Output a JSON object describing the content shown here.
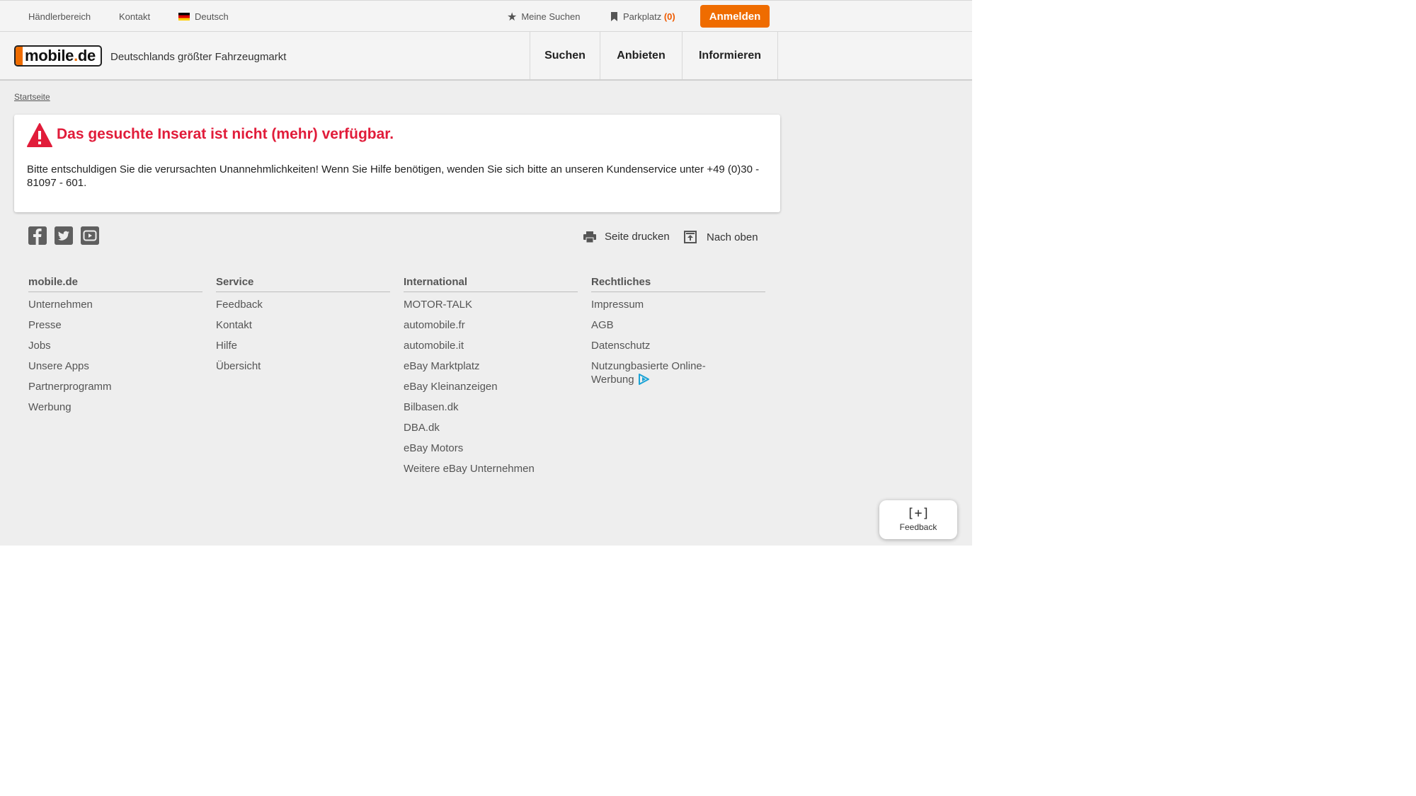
{
  "topbar": {
    "dealer_area": "Händlerbereich",
    "contact": "Kontakt",
    "language": "Deutsch",
    "saved_searches": "Meine Suchen",
    "parking": "Parkplatz",
    "parking_count": "(0)",
    "login": "Anmelden"
  },
  "header": {
    "logo_text": "mobile",
    "logo_dot": ".",
    "logo_tld": "de",
    "tagline": "Deutschlands größter Fahrzeugmarkt",
    "nav": [
      "Suchen",
      "Anbieten",
      "Informieren"
    ]
  },
  "breadcrumb": "Startseite",
  "alert": {
    "title": "Das gesuchte Inserat ist nicht (mehr) verfügbar.",
    "message": "Bitte entschuldigen Sie die verursachten Unannehmlichkeiten! Wenn Sie Hilfe benötigen, wenden Sie sich bitte an unseren Kundenservice unter +49 (0)30 - 81097 - 601."
  },
  "tools": {
    "print": "Seite drucken",
    "top": "Nach oben"
  },
  "footer": {
    "columns": [
      {
        "title": "mobile.de",
        "links": [
          "Unternehmen",
          "Presse",
          "Jobs",
          "Unsere Apps",
          "Partnerprogramm",
          "Werbung"
        ]
      },
      {
        "title": "Service",
        "links": [
          "Feedback",
          "Kontakt",
          "Hilfe",
          "Übersicht"
        ]
      },
      {
        "title": "International",
        "links": [
          "MOTOR-TALK",
          "automobile.fr",
          "automobile.it",
          "eBay Marktplatz",
          "eBay Kleinanzeigen",
          "Bilbasen.dk",
          "DBA.dk",
          "eBay Motors",
          "Weitere eBay Unternehmen"
        ]
      },
      {
        "title": "Rechtliches",
        "links": [
          "Impressum",
          "AGB",
          "Datenschutz"
        ],
        "ad_link": "Nutzungbasierte Online-Werbung"
      }
    ]
  },
  "feedback_widget": {
    "icon": "[+]",
    "label": "Feedback"
  },
  "colors": {
    "accent": "#ef6c00",
    "error": "#e11c3a",
    "background": "#eeeeee"
  },
  "icons": [
    "star-icon",
    "bookmark-icon",
    "warning-icon",
    "facebook-icon",
    "twitter-icon",
    "youtube-icon",
    "printer-icon",
    "arrow-up-icon",
    "adchoices-icon"
  ]
}
